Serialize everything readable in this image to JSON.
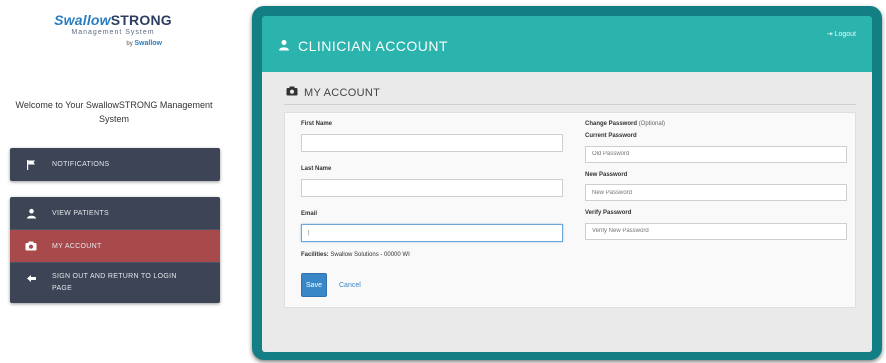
{
  "logo": {
    "brand_a": "Swallow",
    "brand_b": "STRONG",
    "subtitle": "Management System",
    "by_text": "by",
    "by_brand": "Swallow"
  },
  "welcome": "Welcome to Your SwallowSTRONG Management System",
  "sidebar": {
    "notifications": {
      "label": "NOTIFICATIONS",
      "icon": "flag-icon"
    },
    "items": [
      {
        "label": "VIEW PATIENTS",
        "icon": "user-icon"
      },
      {
        "label": "MY ACCOUNT",
        "icon": "camera-icon",
        "active": true
      },
      {
        "label": "SIGN OUT AND RETURN TO LOGIN PAGE",
        "icon": "sign-out-icon"
      }
    ]
  },
  "header": {
    "title": "CLINICIAN ACCOUNT",
    "logout": "Logout"
  },
  "section": {
    "title": "MY ACCOUNT"
  },
  "form": {
    "first_name_label": "First Name",
    "first_name_value": "",
    "last_name_label": "Last Name",
    "last_name_value": "",
    "email_label": "Email",
    "email_value": "|",
    "facilities_label": "Facilities:",
    "facilities_value": "Swallow Solutions - 00000 WI",
    "save_label": "Save",
    "cancel_label": "Cancel"
  },
  "password": {
    "heading": "Change Password",
    "optional": "(Optional)",
    "current_label": "Current Password",
    "current_placeholder": "Old Password",
    "new_label": "New Password",
    "new_placeholder": "New Password",
    "verify_label": "Verify Password",
    "verify_placeholder": "Verify New Password"
  },
  "colors": {
    "teal_header": "#2bb3ad",
    "frame": "#137f84",
    "nav_bg": "#3d4456",
    "nav_active": "#a84a4b",
    "primary": "#3a87c8"
  }
}
